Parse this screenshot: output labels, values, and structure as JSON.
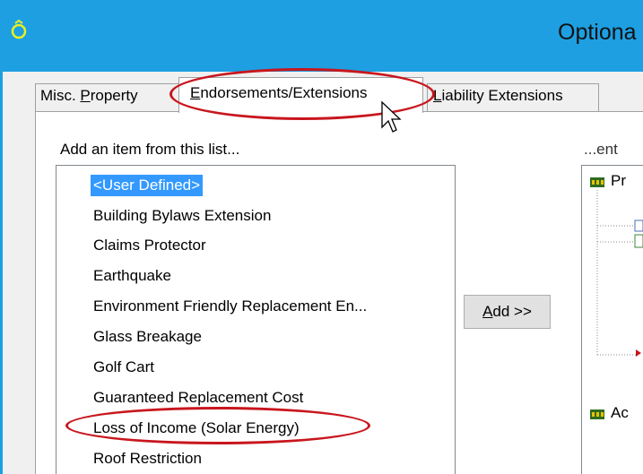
{
  "window": {
    "title": "Optiona",
    "title_icon": "ring-icon",
    "accent": "#1d9fe2"
  },
  "tabs": [
    {
      "pre": "Misc. ",
      "u": "P",
      "post": "roperty",
      "selected": false
    },
    {
      "pre": "",
      "u": "E",
      "post": "ndorsements/Extensions",
      "selected": true
    },
    {
      "pre": "",
      "u": "L",
      "post": "iability Extensions",
      "selected": false
    }
  ],
  "left_panel": {
    "caption": "Add an item from this list...",
    "items": [
      "<User Defined>",
      "Building Bylaws Extension",
      "Claims Protector",
      "Earthquake",
      "Environment Friendly Replacement En...",
      "Glass Breakage",
      "Golf Cart",
      "Guaranteed Replacement Cost",
      "Loss of Income (Solar Energy)",
      "Roof Restriction"
    ],
    "selected_index": 0
  },
  "add_button": {
    "u": "A",
    "post": "dd >>"
  },
  "right_panel": {
    "caption": "...ent",
    "tree": [
      {
        "label": "Pr"
      },
      {
        "label": "Ac"
      }
    ]
  },
  "annotation_color": "#c8161d"
}
